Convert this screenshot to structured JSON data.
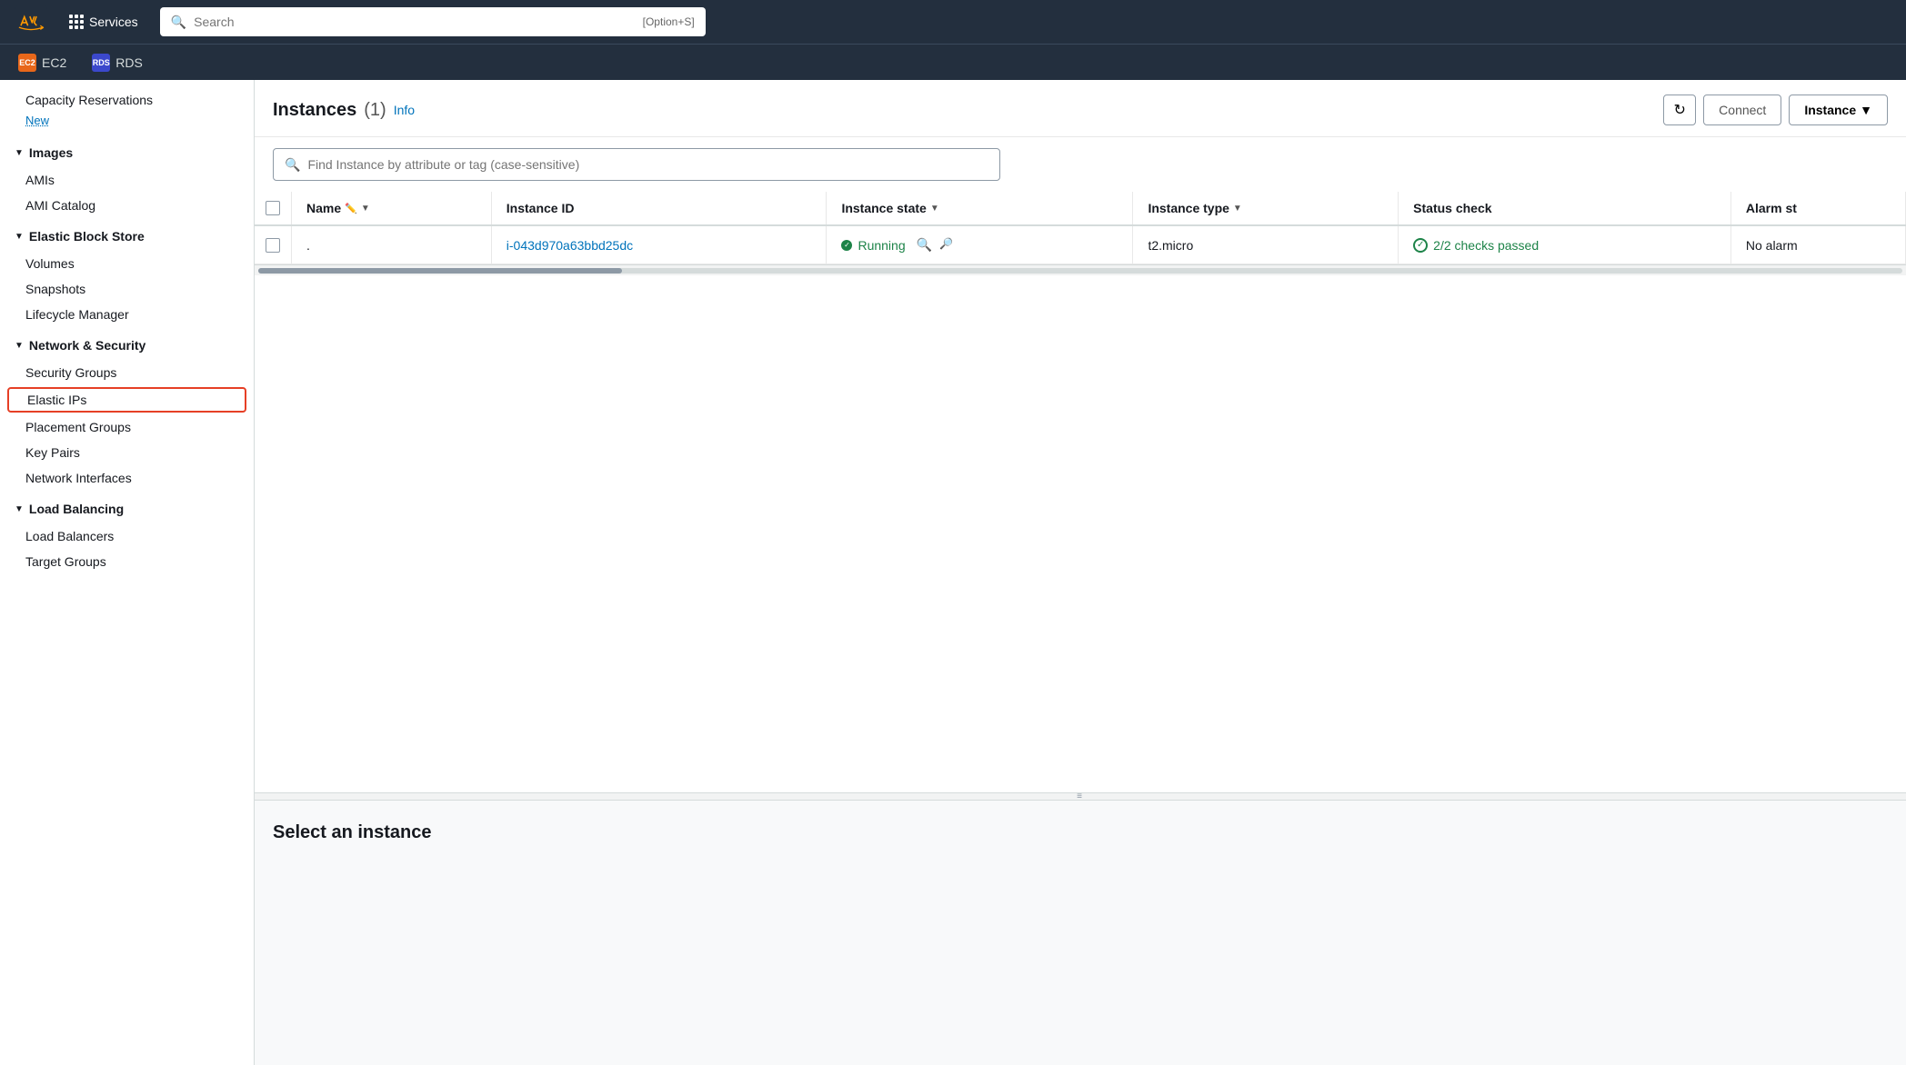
{
  "topNav": {
    "searchPlaceholder": "Search",
    "searchShortcut": "[Option+S]",
    "servicesLabel": "Services"
  },
  "serviceTabs": [
    {
      "id": "ec2",
      "label": "EC2",
      "iconClass": "ec2-icon",
      "iconText": "EC2"
    },
    {
      "id": "rds",
      "label": "RDS",
      "iconClass": "rds-icon",
      "iconText": "RDS"
    }
  ],
  "sidebar": {
    "sections": [
      {
        "id": "capacity",
        "label": "",
        "items": [
          {
            "id": "capacity-reservations",
            "label": "Capacity Reservations",
            "hasNew": true
          }
        ]
      },
      {
        "id": "images",
        "label": "Images",
        "items": [
          {
            "id": "amis",
            "label": "AMIs"
          },
          {
            "id": "ami-catalog",
            "label": "AMI Catalog"
          }
        ]
      },
      {
        "id": "elastic-block-store",
        "label": "Elastic Block Store",
        "items": [
          {
            "id": "volumes",
            "label": "Volumes"
          },
          {
            "id": "snapshots",
            "label": "Snapshots"
          },
          {
            "id": "lifecycle-manager",
            "label": "Lifecycle Manager"
          }
        ]
      },
      {
        "id": "network-security",
        "label": "Network & Security",
        "items": [
          {
            "id": "security-groups",
            "label": "Security Groups"
          },
          {
            "id": "elastic-ips",
            "label": "Elastic IPs",
            "active": true
          },
          {
            "id": "placement-groups",
            "label": "Placement Groups"
          },
          {
            "id": "key-pairs",
            "label": "Key Pairs"
          },
          {
            "id": "network-interfaces",
            "label": "Network Interfaces"
          }
        ]
      },
      {
        "id": "load-balancing",
        "label": "Load Balancing",
        "items": [
          {
            "id": "load-balancers",
            "label": "Load Balancers"
          },
          {
            "id": "target-groups",
            "label": "Target Groups"
          }
        ]
      }
    ]
  },
  "instancesPanel": {
    "title": "Instances",
    "count": "(1)",
    "infoLabel": "Info",
    "refreshLabel": "↻",
    "connectLabel": "Connect",
    "instanceStateLabel": "Instance",
    "filterPlaceholder": "Find Instance by attribute or tag (case-sensitive)",
    "columns": [
      {
        "id": "name",
        "label": "Name",
        "sortable": true
      },
      {
        "id": "instance-id",
        "label": "Instance ID",
        "sortable": false
      },
      {
        "id": "instance-state",
        "label": "Instance state",
        "sortable": true
      },
      {
        "id": "instance-type",
        "label": "Instance type",
        "sortable": true
      },
      {
        "id": "status-check",
        "label": "Status check",
        "sortable": false
      },
      {
        "id": "alarm-status",
        "label": "Alarm st",
        "sortable": false
      }
    ],
    "rows": [
      {
        "name": ".",
        "instanceId": "i-043d970a63bbd25dc",
        "instanceState": "Running",
        "instanceType": "t2.micro",
        "statusCheck": "2/2 checks passed",
        "alarmStatus": "No alarm"
      }
    ],
    "lowerPanel": {
      "message": "Select an instance"
    }
  }
}
